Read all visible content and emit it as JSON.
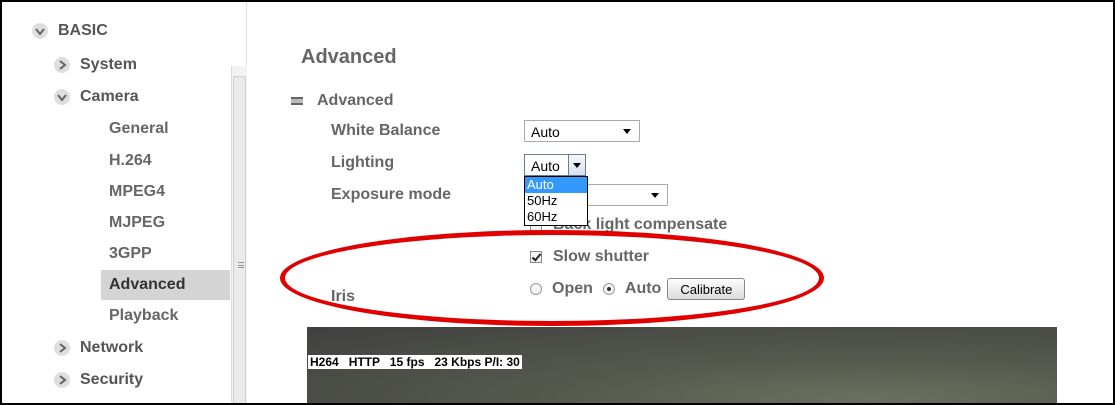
{
  "sidebar": {
    "section": "BASIC",
    "items": [
      {
        "label": "System"
      },
      {
        "label": "Camera"
      },
      {
        "label": "Network"
      },
      {
        "label": "Security"
      }
    ],
    "camera_subitems": [
      "General",
      "H.264",
      "MPEG4",
      "MJPEG",
      "3GPP",
      "Advanced",
      "Playback"
    ],
    "active": "Advanced"
  },
  "main": {
    "title": "Advanced",
    "section": "Advanced",
    "white_balance": {
      "label": "White Balance",
      "value": "Auto"
    },
    "lighting": {
      "label": "Lighting",
      "value": "Auto",
      "options": [
        "Auto",
        "50Hz",
        "60Hz"
      ]
    },
    "exposure_mode": {
      "label": "Exposure mode"
    },
    "back_light": {
      "label": "Back light compensate",
      "checked": false
    },
    "slow_shutter": {
      "label": "Slow shutter",
      "checked": true
    },
    "iris": {
      "label": "Iris",
      "open_label": "Open",
      "auto_label": "Auto",
      "selected": "Auto",
      "calibrate_label": "Calibrate"
    },
    "video_overlay": "H264   HTTP   15 fps   23 Kbps P/I: 30"
  },
  "colors": {
    "annotation": "#e10000",
    "highlight": "#3399ff"
  }
}
